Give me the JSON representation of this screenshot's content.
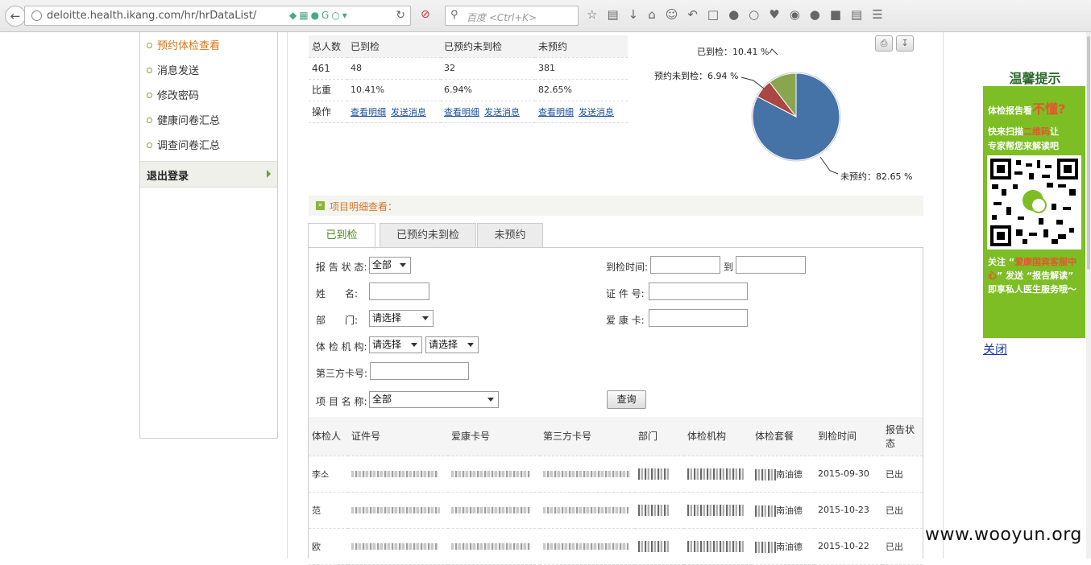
{
  "browser": {
    "url": "deloitte.health.ikang.com/hr/hrDataList/",
    "search_placeholder": "百度 <Ctrl+K>"
  },
  "sidebar": {
    "items": [
      {
        "label": "预约体检查看",
        "active": true
      },
      {
        "label": "消息发送"
      },
      {
        "label": "修改密码"
      },
      {
        "label": "健康问卷汇总"
      },
      {
        "label": "调查问卷汇总"
      }
    ],
    "logout_label": "退出登录"
  },
  "stats": {
    "headers": [
      "总人数",
      "已到检",
      "已预约未到检",
      "未预约"
    ],
    "counts": [
      "461",
      "48",
      "32",
      "381"
    ],
    "ratio_label": "比重",
    "ratios": [
      "10.41%",
      "6.94%",
      "82.65%"
    ],
    "action_label": "操作",
    "view_link": "查看明细",
    "send_link": "发送消息"
  },
  "chart_data": {
    "type": "pie",
    "slices": [
      {
        "label": "未预约",
        "value": 82.65,
        "color": "#4572a7"
      },
      {
        "label": "预约未到检",
        "value": 6.94,
        "color": "#aa4643"
      },
      {
        "label": "已到检",
        "value": 10.41,
        "color": "#89a54e"
      }
    ],
    "label_texts": {
      "arrived": "已到检：10.41 %",
      "booked": "预约未到检：6.94 %",
      "unbooked": "未预约：82.65 %"
    }
  },
  "section_title": "项目明细查看：",
  "tabs": [
    "已到检",
    "已预约未到检",
    "未预约"
  ],
  "form": {
    "status_label": "报 告 状 态:",
    "status_value": "全部",
    "name_label": "姓　　名:",
    "dept_label": "部　　门:",
    "dept_value": "请选择",
    "org_label": "体 检 机 构:",
    "org_value1": "请选择",
    "org_value2": "请选择",
    "third_card_label": "第三方卡号:",
    "project_label": "项 目 名 称:",
    "project_value": "全部",
    "arrive_time_label": "到检时间:",
    "to_label": "到",
    "id_label": "证 件 号:",
    "card_label": "爱 康 卡:",
    "query_button": "查询"
  },
  "results": {
    "headers": [
      "体检人",
      "证件号",
      "爱康卡号",
      "第三方卡号",
      "部门",
      "体检机构",
      "体检套餐",
      "到检时间",
      "报告状态"
    ],
    "rows": [
      {
        "name": "李소",
        "package_suffix": "南油德",
        "date": "2015-09-30",
        "status": "已出"
      },
      {
        "name": "范",
        "package_suffix": "南油德",
        "date": "2015-10-23",
        "status": "已出"
      },
      {
        "name": "欧",
        "package_suffix": "南油德",
        "date": "2015-10-22",
        "status": "已出"
      }
    ]
  },
  "ad": {
    "title": "温馨提示",
    "line1a": "体检报告看",
    "line1b": "不懂?",
    "line2a": "快来扫描",
    "line2b": "二维码",
    "line2c": "让",
    "line3": "专家帮您来解读吧",
    "line4a": "关注 “",
    "line4b": "爱康国宾客服中心",
    "line4c": "” 发送 “报告解读” 即享私人医生服务哦～",
    "close": "关闭"
  },
  "watermark": "www.wooyun.org"
}
